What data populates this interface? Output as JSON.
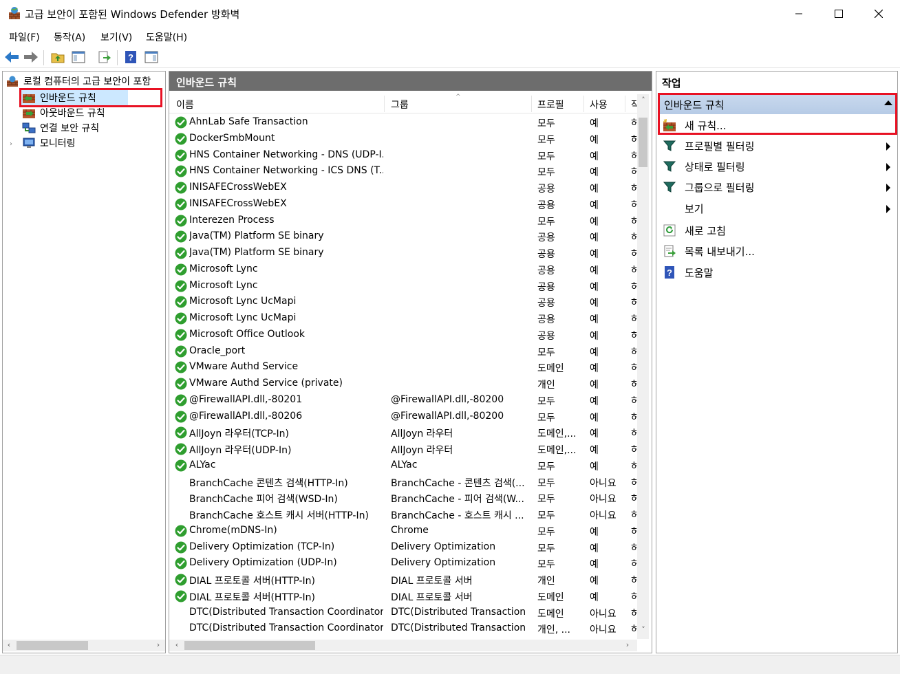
{
  "window": {
    "title": "고급 보안이 포함된 Windows Defender 방화벽"
  },
  "menu": [
    "파일(F)",
    "동작(A)",
    "보기(V)",
    "도움말(H)"
  ],
  "tree": {
    "root": "로컬 컴퓨터의 고급 보안이 포함",
    "items": [
      "인바운드 규칙",
      "아웃바운드 규칙",
      "연결 보안 규칙",
      "모니터링"
    ],
    "selected": "인바운드 규칙"
  },
  "center": {
    "header": "인바운드 규칙",
    "columns": [
      "이름",
      "그룹",
      "프로필",
      "사용",
      "작"
    ],
    "rows": [
      {
        "name": "AhnLab Safe Transaction",
        "group": "",
        "profile": "모두",
        "enabled": "예",
        "action": "허",
        "check": true
      },
      {
        "name": "DockerSmbMount",
        "group": "",
        "profile": "모두",
        "enabled": "예",
        "action": "허",
        "check": true
      },
      {
        "name": "HNS Container Networking - DNS (UDP-I...",
        "group": "",
        "profile": "모두",
        "enabled": "예",
        "action": "허",
        "check": true
      },
      {
        "name": "HNS Container Networking - ICS DNS (T...",
        "group": "",
        "profile": "모두",
        "enabled": "예",
        "action": "허",
        "check": true
      },
      {
        "name": "INISAFECrossWebEX",
        "group": "",
        "profile": "공용",
        "enabled": "예",
        "action": "허",
        "check": true
      },
      {
        "name": "INISAFECrossWebEX",
        "group": "",
        "profile": "공용",
        "enabled": "예",
        "action": "허",
        "check": true
      },
      {
        "name": "Interezen Process",
        "group": "",
        "profile": "모두",
        "enabled": "예",
        "action": "허",
        "check": true
      },
      {
        "name": "Java(TM) Platform SE binary",
        "group": "",
        "profile": "공용",
        "enabled": "예",
        "action": "허",
        "check": true
      },
      {
        "name": "Java(TM) Platform SE binary",
        "group": "",
        "profile": "공용",
        "enabled": "예",
        "action": "허",
        "check": true
      },
      {
        "name": "Microsoft Lync",
        "group": "",
        "profile": "공용",
        "enabled": "예",
        "action": "허",
        "check": true
      },
      {
        "name": "Microsoft Lync",
        "group": "",
        "profile": "공용",
        "enabled": "예",
        "action": "허",
        "check": true
      },
      {
        "name": "Microsoft Lync UcMapi",
        "group": "",
        "profile": "공용",
        "enabled": "예",
        "action": "허",
        "check": true
      },
      {
        "name": "Microsoft Lync UcMapi",
        "group": "",
        "profile": "공용",
        "enabled": "예",
        "action": "허",
        "check": true
      },
      {
        "name": "Microsoft Office Outlook",
        "group": "",
        "profile": "공용",
        "enabled": "예",
        "action": "허",
        "check": true
      },
      {
        "name": "Oracle_port",
        "group": "",
        "profile": "모두",
        "enabled": "예",
        "action": "허",
        "check": true
      },
      {
        "name": "VMware Authd Service",
        "group": "",
        "profile": "도메인",
        "enabled": "예",
        "action": "허",
        "check": true
      },
      {
        "name": "VMware Authd Service (private)",
        "group": "",
        "profile": "개인",
        "enabled": "예",
        "action": "허",
        "check": true
      },
      {
        "name": "@FirewallAPI.dll,-80201",
        "group": "@FirewallAPI.dll,-80200",
        "profile": "모두",
        "enabled": "예",
        "action": "허",
        "check": true
      },
      {
        "name": "@FirewallAPI.dll,-80206",
        "group": "@FirewallAPI.dll,-80200",
        "profile": "모두",
        "enabled": "예",
        "action": "허",
        "check": true
      },
      {
        "name": "AllJoyn 라우터(TCP-In)",
        "group": "AllJoyn 라우터",
        "profile": "도메인,...",
        "enabled": "예",
        "action": "허",
        "check": true
      },
      {
        "name": "AllJoyn 라우터(UDP-In)",
        "group": "AllJoyn 라우터",
        "profile": "도메인,...",
        "enabled": "예",
        "action": "허",
        "check": true
      },
      {
        "name": "ALYac",
        "group": "ALYac",
        "profile": "모두",
        "enabled": "예",
        "action": "허",
        "check": true
      },
      {
        "name": "BranchCache 콘텐츠 검색(HTTP-In)",
        "group": "BranchCache - 콘텐츠 검색(...",
        "profile": "모두",
        "enabled": "아니요",
        "action": "허",
        "check": false
      },
      {
        "name": "BranchCache 피어 검색(WSD-In)",
        "group": "BranchCache - 피어 검색(W...",
        "profile": "모두",
        "enabled": "아니요",
        "action": "허",
        "check": false
      },
      {
        "name": "BranchCache 호스트 캐시 서버(HTTP-In)",
        "group": "BranchCache - 호스트 캐시 ...",
        "profile": "모두",
        "enabled": "아니요",
        "action": "허",
        "check": false
      },
      {
        "name": "Chrome(mDNS-In)",
        "group": "Chrome",
        "profile": "모두",
        "enabled": "예",
        "action": "허",
        "check": true
      },
      {
        "name": "Delivery Optimization (TCP-In)",
        "group": "Delivery Optimization",
        "profile": "모두",
        "enabled": "예",
        "action": "허",
        "check": true
      },
      {
        "name": "Delivery Optimization (UDP-In)",
        "group": "Delivery Optimization",
        "profile": "모두",
        "enabled": "예",
        "action": "허",
        "check": true
      },
      {
        "name": "DIAL 프로토콜 서버(HTTP-In)",
        "group": "DIAL 프로토콜 서버",
        "profile": "개인",
        "enabled": "예",
        "action": "허",
        "check": true
      },
      {
        "name": "DIAL 프로토콜 서버(HTTP-In)",
        "group": "DIAL 프로토콜 서버",
        "profile": "도메인",
        "enabled": "예",
        "action": "허",
        "check": true
      },
      {
        "name": "DTC(Distributed Transaction Coordinator)...",
        "group": "DTC(Distributed Transaction ...",
        "profile": "도메인",
        "enabled": "아니요",
        "action": "허",
        "check": false
      },
      {
        "name": "DTC(Distributed Transaction Coordinator)...",
        "group": "DTC(Distributed Transaction ...",
        "profile": "개인, ...",
        "enabled": "아니요",
        "action": "허",
        "check": false
      }
    ]
  },
  "actions": {
    "title": "작업",
    "section": "인바운드 규칙",
    "items": [
      {
        "label": "새 규칙...",
        "icon": "new-rule-icon",
        "submenu": false
      },
      {
        "label": "프로필별 필터링",
        "icon": "filter-icon",
        "submenu": true
      },
      {
        "label": "상태로 필터링",
        "icon": "filter-icon",
        "submenu": true
      },
      {
        "label": "그룹으로 필터링",
        "icon": "filter-icon",
        "submenu": true
      },
      {
        "label": "보기",
        "icon": "",
        "submenu": true
      },
      {
        "label": "새로 고침",
        "icon": "refresh-icon",
        "submenu": false
      },
      {
        "label": "목록 내보내기...",
        "icon": "export-icon",
        "submenu": false
      },
      {
        "label": "도움말",
        "icon": "help-icon",
        "submenu": false
      }
    ]
  },
  "colors": {
    "highlight_box": "#e81123",
    "selection": "#cce8ff",
    "pane_header": "#6d6d6d",
    "check_green": "#2f9e2f"
  }
}
